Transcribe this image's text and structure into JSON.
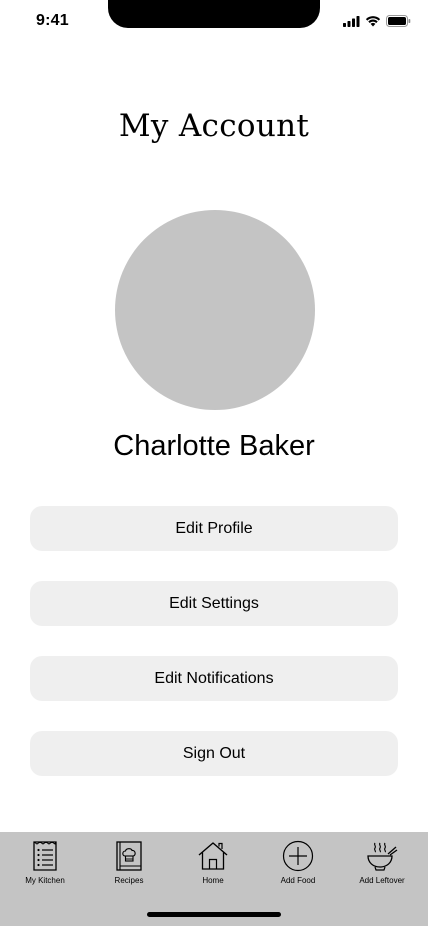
{
  "status_bar": {
    "time": "9:41",
    "icons": [
      "cellular-signal-icon",
      "wifi-icon",
      "battery-icon"
    ]
  },
  "page": {
    "title": "My Account"
  },
  "profile": {
    "avatar_color": "#c4c4c4",
    "name": "Charlotte Baker"
  },
  "actions": {
    "edit_profile": "Edit Profile",
    "edit_settings": "Edit Settings",
    "edit_notifications": "Edit Notifications",
    "sign_out": "Sign Out"
  },
  "tab_bar": {
    "background": "#c4c4c4",
    "items": [
      {
        "label": "My Kitchen",
        "icon": "list-document-icon"
      },
      {
        "label": "Recipes",
        "icon": "recipe-book-icon"
      },
      {
        "label": "Home",
        "icon": "home-icon"
      },
      {
        "label": "Add Food",
        "icon": "plus-circle-icon"
      },
      {
        "label": "Add Leftover",
        "icon": "steaming-bowl-icon"
      }
    ]
  },
  "colors": {
    "button_background": "#efefef",
    "background": "#ffffff"
  }
}
